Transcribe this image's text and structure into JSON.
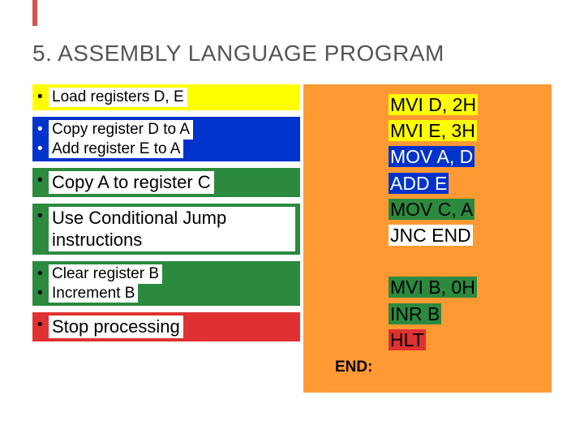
{
  "title": "5. ASSEMBLY LANGUAGE PROGRAM",
  "left": {
    "group1": {
      "color": "yellow",
      "items": [
        "Load registers D, E"
      ]
    },
    "group2": {
      "color": "blue",
      "items": [
        "Copy register D to A",
        "Add register E to A"
      ]
    },
    "group3": {
      "color": "green",
      "items": [
        "Copy A to register C"
      ]
    },
    "group4": {
      "color": "green",
      "items": [
        "Use Conditional Jump instructions"
      ]
    },
    "group5": {
      "color": "green",
      "items": [
        "Clear register B",
        "Increment B"
      ]
    },
    "group6": {
      "color": "red",
      "items": [
        "Stop processing"
      ]
    }
  },
  "end_label": "END:",
  "code": [
    {
      "text": "MVI D, 2H",
      "bg": "yellow"
    },
    {
      "text": "MVI E, 3H",
      "bg": "yellow"
    },
    {
      "text": "MOV A, D",
      "bg": "blue"
    },
    {
      "text": "ADD E",
      "bg": "blue"
    },
    {
      "text": "MOV C, A",
      "bg": "green"
    },
    {
      "text": "JNC END",
      "bg": "white"
    },
    {
      "text": "",
      "bg": "none"
    },
    {
      "text": "MVI B, 0H",
      "bg": "green"
    },
    {
      "text": "INR B",
      "bg": "green"
    },
    {
      "text": "HLT",
      "bg": "red"
    }
  ]
}
